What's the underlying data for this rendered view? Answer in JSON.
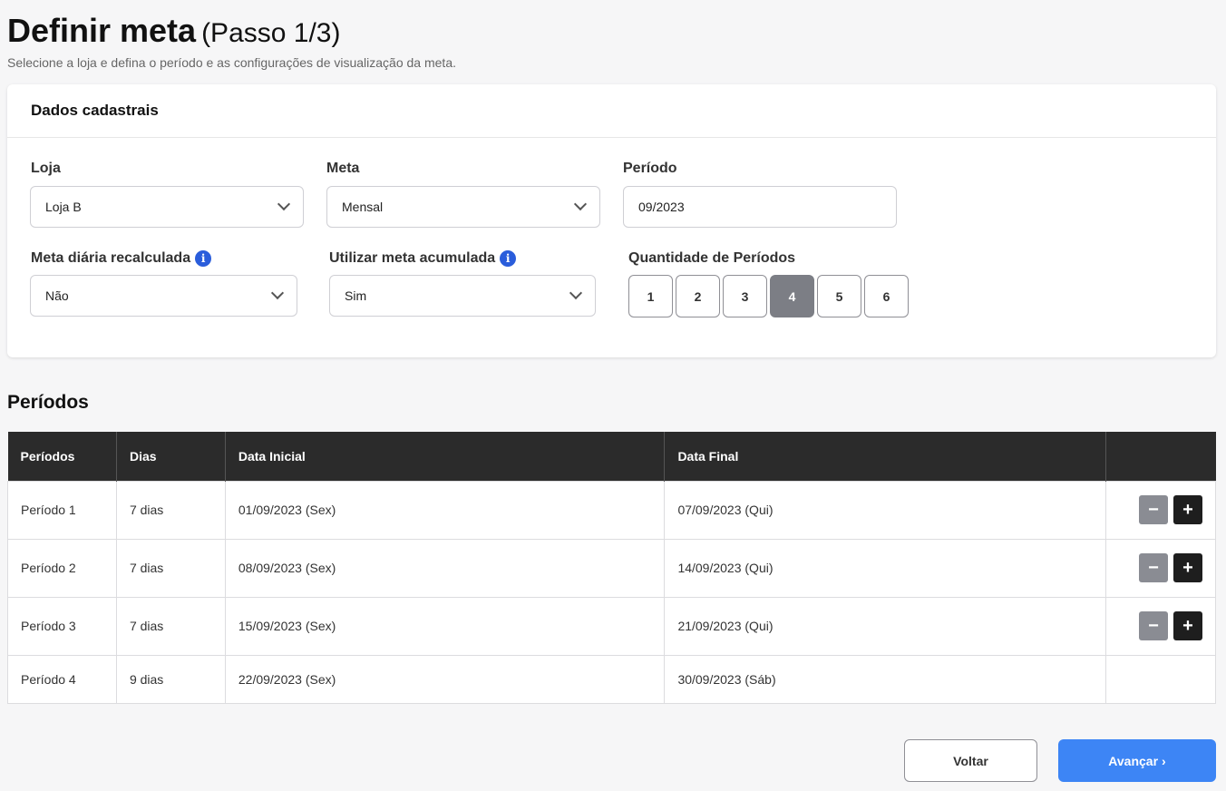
{
  "header": {
    "title": "Definir meta",
    "step": "(Passo 1/3)",
    "subtitle": "Selecione a loja e defina o período e as configurações de visualização da meta."
  },
  "card": {
    "title": "Dados cadastrais",
    "loja": {
      "label": "Loja",
      "value": "Loja B"
    },
    "meta": {
      "label": "Meta",
      "value": "Mensal"
    },
    "periodo": {
      "label": "Período",
      "value": "09/2023"
    },
    "meta_diaria": {
      "label": "Meta diária recalculada",
      "value": "Não"
    },
    "meta_acumulada": {
      "label": "Utilizar meta acumulada",
      "value": "Sim"
    },
    "quantidade": {
      "label": "Quantidade de Períodos",
      "options": [
        "1",
        "2",
        "3",
        "4",
        "5",
        "6"
      ],
      "selected": "4"
    }
  },
  "periods_section": {
    "title": "Períodos",
    "columns": [
      "Períodos",
      "Dias",
      "Data Inicial",
      "Data Final",
      ""
    ],
    "rows": [
      {
        "name": "Período 1",
        "days": "7 dias",
        "start": "01/09/2023 (Sex)",
        "end": "07/09/2023 (Qui)",
        "actions": true
      },
      {
        "name": "Período 2",
        "days": "7 dias",
        "start": "08/09/2023 (Sex)",
        "end": "14/09/2023 (Qui)",
        "actions": true
      },
      {
        "name": "Período 3",
        "days": "7 dias",
        "start": "15/09/2023 (Sex)",
        "end": "21/09/2023 (Qui)",
        "actions": true
      },
      {
        "name": "Período 4",
        "days": "9 dias",
        "start": "22/09/2023 (Sex)",
        "end": "30/09/2023 (Sáb)",
        "actions": false
      }
    ]
  },
  "footer": {
    "back_label": "Voltar",
    "next_label": "Avançar",
    "next_icon": "chevron-right-icon"
  },
  "colors": {
    "primary": "#3d85f5",
    "info": "#2a5ddb",
    "table_header": "#2b2b2b",
    "active_qty": "#7c7e85"
  }
}
